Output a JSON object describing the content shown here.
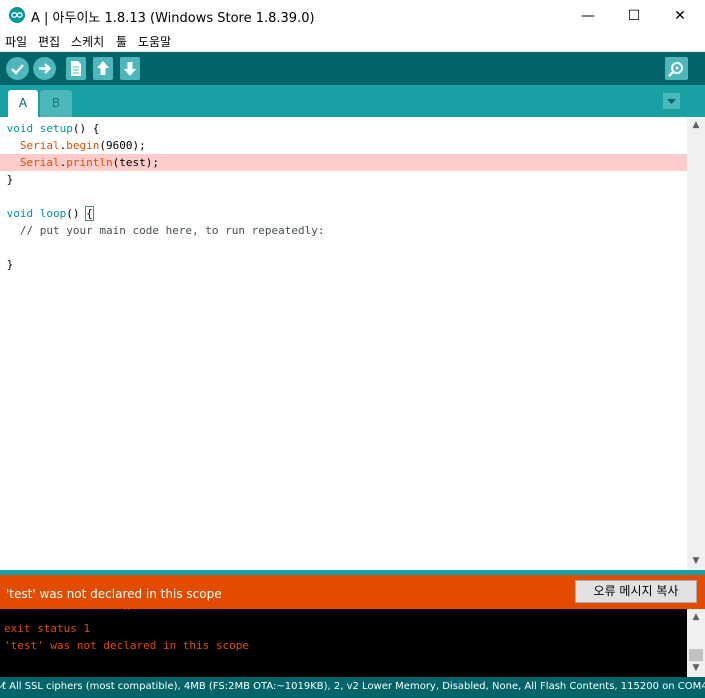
{
  "window": {
    "title": "A | 아두이노 1.8.13 (Windows Store 1.8.39.0)",
    "minimize_glyph": "—",
    "maximize_glyph": "☐",
    "close_glyph": "✕"
  },
  "menu": [
    "파일",
    "편집",
    "스케치",
    "툴",
    "도움말"
  ],
  "toolbar": {
    "icons": [
      "verify-icon",
      "upload-icon",
      "new-icon",
      "open-icon",
      "save-icon",
      "serial-monitor-icon"
    ]
  },
  "tabs": [
    {
      "label": "A",
      "active": true
    },
    {
      "label": "B",
      "active": false
    }
  ],
  "editor": {
    "lines": [
      {
        "parts": [
          {
            "t": "void",
            "c": "kw"
          },
          {
            "t": " "
          },
          {
            "t": "setup",
            "c": "kw"
          },
          {
            "t": "() {"
          }
        ]
      },
      {
        "parts": [
          {
            "t": "  "
          },
          {
            "t": "Serial",
            "c": "fn"
          },
          {
            "t": "."
          },
          {
            "t": "begin",
            "c": "fn"
          },
          {
            "t": "(9600);"
          }
        ]
      },
      {
        "error": true,
        "parts": [
          {
            "t": "  "
          },
          {
            "t": "Serial",
            "c": "fn"
          },
          {
            "t": "."
          },
          {
            "t": "println",
            "c": "fn"
          },
          {
            "t": "(test);"
          }
        ]
      },
      {
        "parts": [
          {
            "t": "}"
          }
        ]
      },
      {
        "parts": []
      },
      {
        "parts": [
          {
            "t": "void",
            "c": "kw"
          },
          {
            "t": " "
          },
          {
            "t": "loop",
            "c": "kw"
          },
          {
            "t": "() "
          },
          {
            "t": "{",
            "c": "cursor"
          }
        ]
      },
      {
        "parts": [
          {
            "t": "  // put your main code here, to run repeatedly:",
            "c": "comment"
          }
        ]
      },
      {
        "parts": []
      },
      {
        "parts": [
          {
            "t": "}"
          }
        ]
      }
    ]
  },
  "status": {
    "message": "'test' was not declared in this scope",
    "copy_button": "오류 메시지 복사"
  },
  "console": {
    "lines": [
      "                  ^",
      "exit status 1",
      "'test' was not declared in this scope"
    ]
  },
  "footer": {
    "text": "t̸ All SSL ciphers (most compatible), 4MB (FS:2MB OTA:~1019KB), 2, v2 Lower Memory, Disabled, None, All Flash Contents, 115200 on COM4"
  },
  "colors": {
    "teal_dark": "#006468",
    "teal_mid": "#17a1a5",
    "teal_light": "#4db7bb",
    "error_orange": "#e34c00",
    "error_line": "#ffcccc"
  }
}
